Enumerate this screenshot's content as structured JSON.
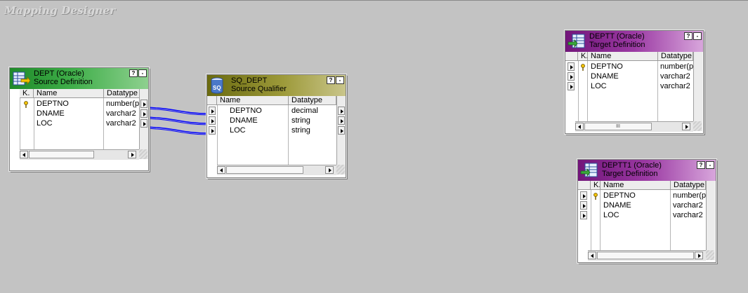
{
  "workspace": {
    "title": "Mapping Designer"
  },
  "header_buttons": {
    "help": "?",
    "minimize": "-"
  },
  "source": {
    "title": "DEPT (Oracle)",
    "subtitle": "Source Definition",
    "columns": {
      "key": "K.",
      "name": "Name",
      "datatype": "Datatype"
    },
    "rows": [
      {
        "name": "DEPTNO",
        "datatype": "number(p"
      },
      {
        "name": "DNAME",
        "datatype": "varchar2"
      },
      {
        "name": "LOC",
        "datatype": "varchar2"
      }
    ]
  },
  "qualifier": {
    "title": "SQ_DEPT",
    "subtitle": "Source Qualifier",
    "icon_text": "SQ",
    "columns": {
      "name": "Name",
      "datatype": "Datatype"
    },
    "rows": [
      {
        "name": "DEPTNO",
        "datatype": "decimal"
      },
      {
        "name": "DNAME",
        "datatype": "string"
      },
      {
        "name": "LOC",
        "datatype": "string"
      }
    ]
  },
  "target1": {
    "title": "DEPTT (Oracle)",
    "subtitle": "Target Definition",
    "scroll_grip": "III",
    "columns": {
      "key": "K.",
      "name": "Name",
      "datatype": "Datatype"
    },
    "rows": [
      {
        "name": "DEPTNO",
        "datatype": "number(p"
      },
      {
        "name": "DNAME",
        "datatype": "varchar2"
      },
      {
        "name": "LOC",
        "datatype": "varchar2"
      }
    ]
  },
  "target2": {
    "title": "DEPTT1 (Oracle)",
    "subtitle": "Target Definition",
    "columns": {
      "key": "K.",
      "name": "Name",
      "datatype": "Datatype"
    },
    "rows": [
      {
        "name": "DEPTNO",
        "datatype": "number(p"
      },
      {
        "name": "DNAME",
        "datatype": "varchar2"
      },
      {
        "name": "LOC",
        "datatype": "varchar2"
      }
    ]
  },
  "colors": {
    "canvas": "#c3c3c3",
    "source_header": "#2f9b3a",
    "qualifier_header": "#9d9a3a",
    "target_header": "#9b3aa3",
    "link": "#0000ff"
  }
}
